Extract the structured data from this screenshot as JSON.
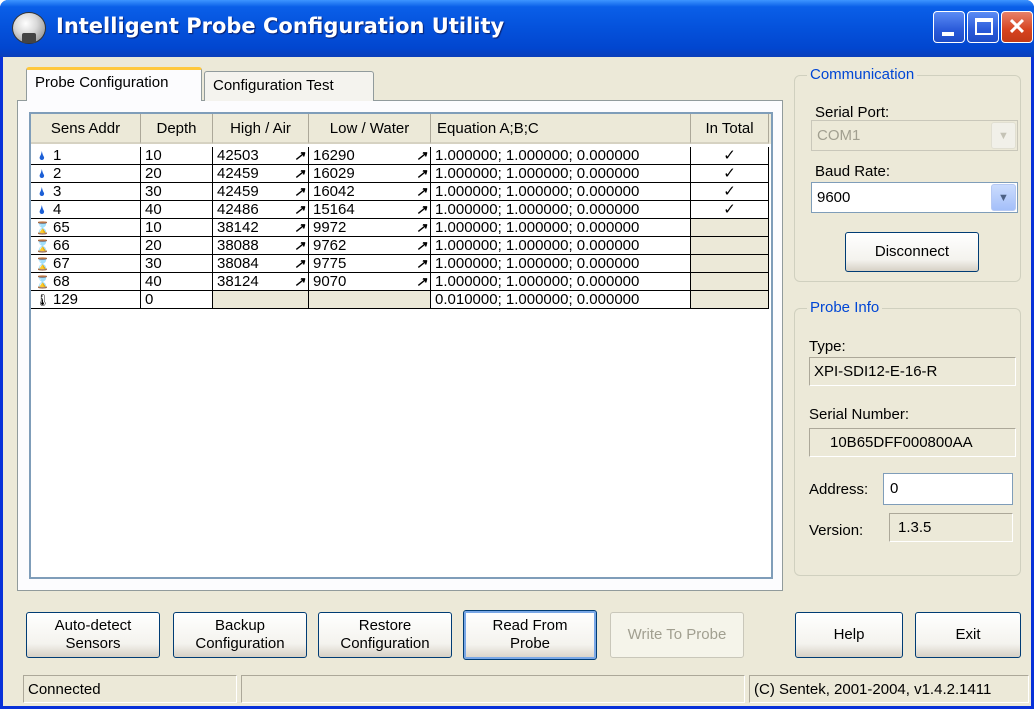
{
  "window": {
    "title": "Intelligent Probe Configuration Utility"
  },
  "tabs": [
    {
      "label": "Probe Configuration",
      "active": true
    },
    {
      "label": "Configuration Test",
      "active": false
    }
  ],
  "grid": {
    "columns": [
      "Sens Addr",
      "Depth",
      "High / Air",
      "Low / Water",
      "Equation  A;B;C",
      "In Total"
    ],
    "rows": [
      {
        "icon": "water-drop-icon",
        "addr": "1",
        "depth": "10",
        "high": "42503",
        "low": "16290",
        "equation": "1.000000; 1.000000; 0.000000",
        "in_total": "✓"
      },
      {
        "icon": "water-drop-icon",
        "addr": "2",
        "depth": "20",
        "high": "42459",
        "low": "16029",
        "equation": "1.000000; 1.000000; 0.000000",
        "in_total": "✓"
      },
      {
        "icon": "water-drop-icon",
        "addr": "3",
        "depth": "30",
        "high": "42459",
        "low": "16042",
        "equation": "1.000000; 1.000000; 0.000000",
        "in_total": "✓"
      },
      {
        "icon": "water-drop-icon",
        "addr": "4",
        "depth": "40",
        "high": "42486",
        "low": "15164",
        "equation": "1.000000; 1.000000; 0.000000",
        "in_total": "✓"
      },
      {
        "icon": "salinity-sensor-icon",
        "addr": "65",
        "depth": "10",
        "high": "38142",
        "low": "9972",
        "equation": "1.000000; 1.000000; 0.000000",
        "in_total": ""
      },
      {
        "icon": "salinity-sensor-icon",
        "addr": "66",
        "depth": "20",
        "high": "38088",
        "low": "9762",
        "equation": "1.000000; 1.000000; 0.000000",
        "in_total": ""
      },
      {
        "icon": "salinity-sensor-icon",
        "addr": "67",
        "depth": "30",
        "high": "38084",
        "low": "9775",
        "equation": "1.000000; 1.000000; 0.000000",
        "in_total": ""
      },
      {
        "icon": "salinity-sensor-icon",
        "addr": "68",
        "depth": "40",
        "high": "38124",
        "low": "9070",
        "equation": "1.000000; 1.000000; 0.000000",
        "in_total": ""
      },
      {
        "icon": "thermometer-icon",
        "addr": "129",
        "depth": "0",
        "high": "",
        "low": "",
        "equation": "0.010000; 1.000000; 0.000000",
        "in_total": ""
      }
    ]
  },
  "communication": {
    "title": "Communication",
    "serial_port_label": "Serial Port:",
    "serial_port_value": "COM1",
    "baud_rate_label": "Baud Rate:",
    "baud_rate_value": "9600",
    "disconnect_label": "Disconnect"
  },
  "probe_info": {
    "title": "Probe Info",
    "type_label": "Type:",
    "type_value": "XPI-SDI12-E-16-R",
    "serial_label": "Serial Number:",
    "serial_value": "10B65DFF000800AA",
    "address_label": "Address:",
    "address_value": "0",
    "version_label": "Version:",
    "version_value": "1.3.5"
  },
  "buttons": {
    "auto_detect_1": "Auto-detect",
    "auto_detect_2": "Sensors",
    "backup_1": "Backup",
    "backup_2": "Configuration",
    "restore_1": "Restore",
    "restore_2": "Configuration",
    "read_1": "Read From",
    "read_2": "Probe",
    "write": "Write To Probe",
    "help": "Help",
    "exit": "Exit"
  },
  "status": {
    "connection": "Connected",
    "middle": "",
    "copyright": "(C) Sentek, 2001-2004, v1.4.2.1411"
  }
}
